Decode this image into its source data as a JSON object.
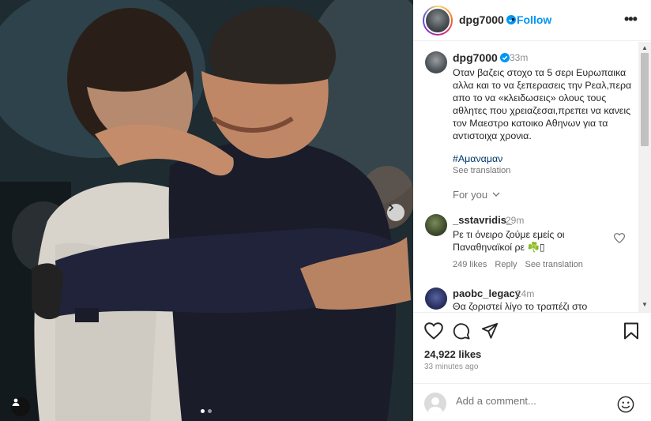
{
  "post": {
    "username": "dpg7000",
    "follow_label": "Follow",
    "separator": "•",
    "more_label": "•••"
  },
  "caption": {
    "username": "dpg7000",
    "time": "33m",
    "text": "Οταν βαζεις στοχο τα 5 σερι Ευρωπαικα αλλα και το να ξεπερασεις την Ρεαλ,περα απο το να «κλειδωσεις» ολους τους αθλητες που χρειαζεσαι,πρεπει να κανεις τον Μαεστρο κατοικο Αθηνων για τα αντιστοιχα χρονια.",
    "hashtag": "#Αμαναμαν",
    "see_translation": "See translation"
  },
  "for_you": {
    "label": "For you",
    "chevron": "⌵"
  },
  "comments": [
    {
      "username": "_sstavridis_",
      "time": "29m",
      "text": "Ρε τι όνειρο ζούμε εμείς οι Παναθηναϊκοί ρε ☘️▯",
      "likes": "249 likes",
      "reply": "Reply",
      "see_translation": "See translation"
    },
    {
      "username": "paobc_legacy",
      "time": "24m",
      "text": "Θα ζοριστεί λίγο το τραπέζι στο"
    }
  ],
  "actions": {
    "likes": "24,922 likes",
    "time_ago": "33 minutes ago"
  },
  "add_comment": {
    "placeholder": "Add a comment..."
  },
  "colors": {
    "accent": "#0095f6",
    "verified": "#0095f6",
    "hashtag": "#00376b",
    "muted": "#737373"
  },
  "icons": [
    "heart-icon",
    "comment-icon",
    "share-icon",
    "bookmark-icon",
    "emoji-icon",
    "verified-icon",
    "more-icon",
    "user-tag-icon",
    "next-arrow-icon"
  ],
  "carousel": {
    "slides": 2,
    "active_index": 0
  }
}
